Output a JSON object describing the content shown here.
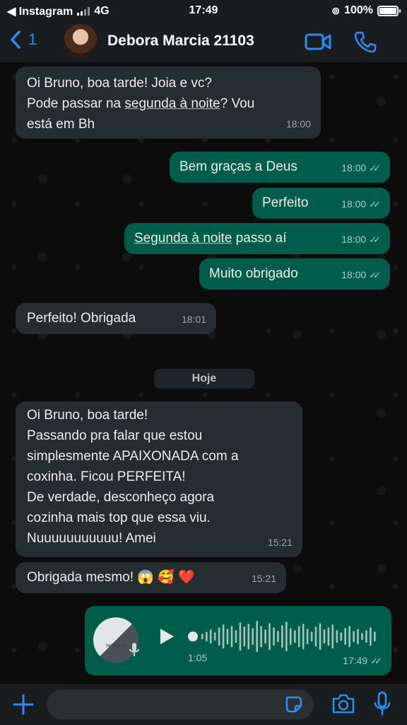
{
  "status_bar": {
    "back_app": "◀ Instagram",
    "network": "4G",
    "time": "17:49",
    "battery": "100%",
    "battery_level": 1.0
  },
  "header": {
    "unread_count": "1",
    "contact_name": "Debora Marcia 21103"
  },
  "messages": [
    {
      "dir": "in",
      "text_a": "Oi Bruno, boa tarde! Joia e vc?\nPode passar na ",
      "link": "segunda à noite",
      "text_b": "? Vou\nestá em Bh",
      "time": "18:00"
    },
    {
      "dir": "out",
      "text": "Bem graças a Deus",
      "time": "18:00"
    },
    {
      "dir": "out",
      "text": "Perfeito",
      "time": "18:00"
    },
    {
      "dir": "out",
      "link": "Segunda à noite",
      "text_b": " passo aí",
      "time": "18:00"
    },
    {
      "dir": "out",
      "text": "Muito obrigado",
      "time": "18:00"
    },
    {
      "dir": "in",
      "text": "Perfeito! Obrigada",
      "time": "18:01"
    },
    {
      "dir": "in",
      "text": "Oi Bruno, boa tarde!\nPassando pra falar que estou\nsimplesmente APAIXONADA com a\ncoxinha. Ficou PERFEITA!\nDe verdade, desconheço agora\ncozinha mais top que essa viu.\nNuuuuuuuuuuu! Amei",
      "time": "15:21"
    },
    {
      "dir": "in",
      "text": "Obrigada mesmo! 😱 🥰 ❤️",
      "time": "15:21"
    }
  ],
  "day_chip": "Hoje",
  "audio": {
    "thumb_label": "IMPÉRIO DESIGN",
    "duration": "1:05",
    "time": "17:49",
    "progress": 0.0
  },
  "colors": {
    "incoming": "#262d31",
    "outgoing": "#005c4b",
    "accent": "#2a8cf4"
  },
  "icons": [
    "chevron-left-icon",
    "video-call-icon",
    "phone-icon",
    "plus-icon",
    "sticker-icon",
    "camera-icon",
    "mic-icon",
    "play-icon",
    "double-check-icon"
  ]
}
